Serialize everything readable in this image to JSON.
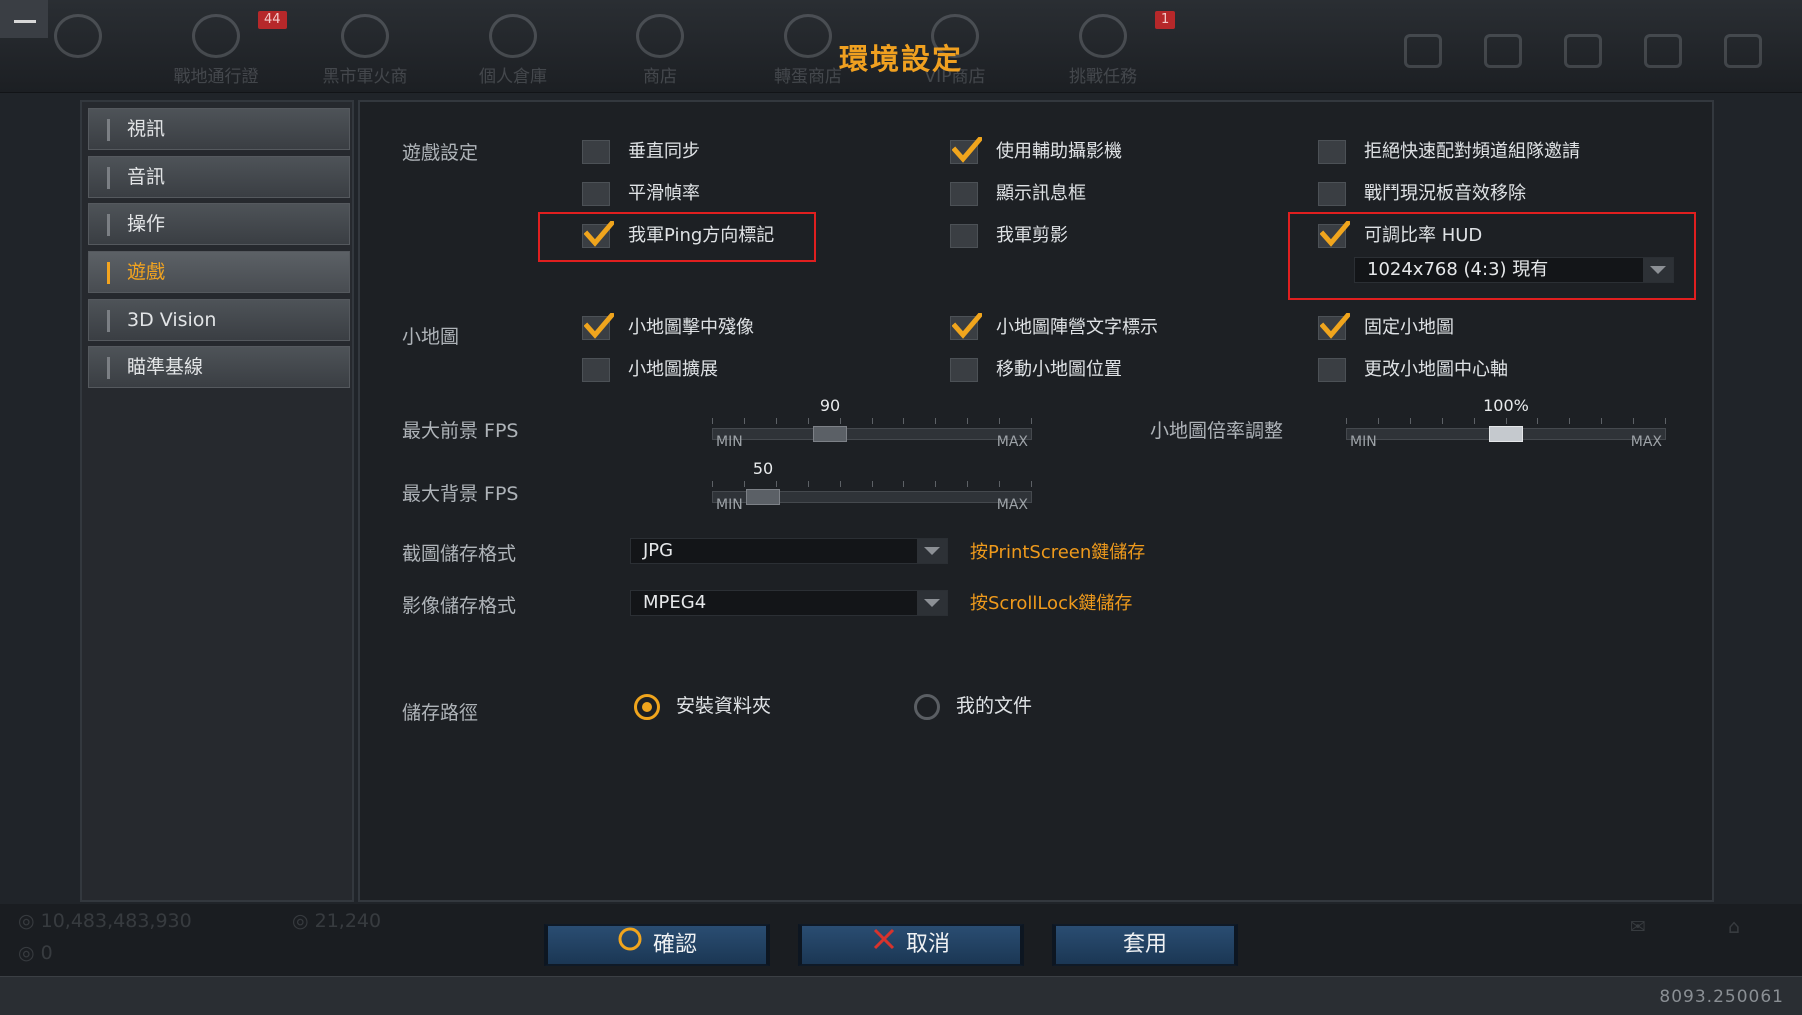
{
  "window": {
    "title": "環境設定"
  },
  "top_nav": [
    {
      "label": "戰地通行證",
      "badge": "44"
    },
    {
      "label": "黑市軍火商"
    },
    {
      "label": "個人倉庫"
    },
    {
      "label": "商店"
    },
    {
      "label": "轉蛋商店"
    },
    {
      "label": "VIP商店",
      "badge": "1"
    },
    {
      "label": "挑戰任務"
    }
  ],
  "sidebar": {
    "items": [
      {
        "label": "視訊"
      },
      {
        "label": "音訊"
      },
      {
        "label": "操作"
      },
      {
        "label": "遊戲",
        "active": true
      },
      {
        "label": "3D Vision"
      },
      {
        "label": "瞄準基線"
      }
    ]
  },
  "game_settings": {
    "label": "遊戲設定",
    "options": {
      "vsync": {
        "label": "垂直同步",
        "checked": false
      },
      "assist_camera": {
        "label": "使用輔助攝影機",
        "checked": true
      },
      "reject_invite": {
        "label": "拒絕快速配對頻道組隊邀請",
        "checked": false
      },
      "smooth_fps": {
        "label": "平滑幀率",
        "checked": false
      },
      "show_msgbox": {
        "label": "顯示訊息框",
        "checked": false
      },
      "remove_sfx": {
        "label": "戰鬥現況板音效移除",
        "checked": false
      },
      "ping_marker": {
        "label": "我軍Ping方向標記",
        "checked": true
      },
      "silhouette": {
        "label": "我軍剪影",
        "checked": false
      },
      "scalable_hud": {
        "label": "可調比率 HUD",
        "checked": true
      }
    },
    "hud_resolution": "1024x768 (4:3) 現有"
  },
  "minimap": {
    "label": "小地圖",
    "options": {
      "hit_afterimage": {
        "label": "小地圖擊中殘像",
        "checked": true
      },
      "faction_text": {
        "label": "小地圖陣營文字標示",
        "checked": true
      },
      "fixed": {
        "label": "固定小地圖",
        "checked": true
      },
      "expand": {
        "label": "小地圖擴展",
        "checked": false
      },
      "move": {
        "label": "移動小地圖位置",
        "checked": false
      },
      "change_center": {
        "label": "更改小地圖中心軸",
        "checked": false
      }
    }
  },
  "sliders": {
    "min_label": "MIN",
    "max_label": "MAX",
    "fg_fps": {
      "label": "最大前景 FPS",
      "value": "90",
      "fraction": 0.37
    },
    "bg_fps": {
      "label": "最大背景 FPS",
      "value": "50",
      "fraction": 0.16
    },
    "minimap_scale": {
      "label": "小地圖倍率調整",
      "value": "100%",
      "fraction": 0.5
    }
  },
  "capture": {
    "label": "截圖儲存格式",
    "value": "JPG",
    "hint": "按PrintScreen鍵儲存"
  },
  "video": {
    "label": "影像儲存格式",
    "value": "MPEG4",
    "hint": "按ScrollLock鍵儲存"
  },
  "save_path": {
    "label": "儲存路徑",
    "options": [
      {
        "label": "安裝資料夾",
        "selected": true
      },
      {
        "label": "我的文件",
        "selected": false
      }
    ]
  },
  "currency": {
    "gold": "10,483,483,930",
    "cash": "21,240",
    "points": "0"
  },
  "buttons": {
    "confirm": "確認",
    "cancel": "取消",
    "apply": "套用"
  },
  "version": "8093.250061",
  "colors": {
    "accent": "#f0a51d",
    "highlight": "#e01f1f",
    "hint": "#ef9a1c",
    "button": "#1f3f61"
  }
}
